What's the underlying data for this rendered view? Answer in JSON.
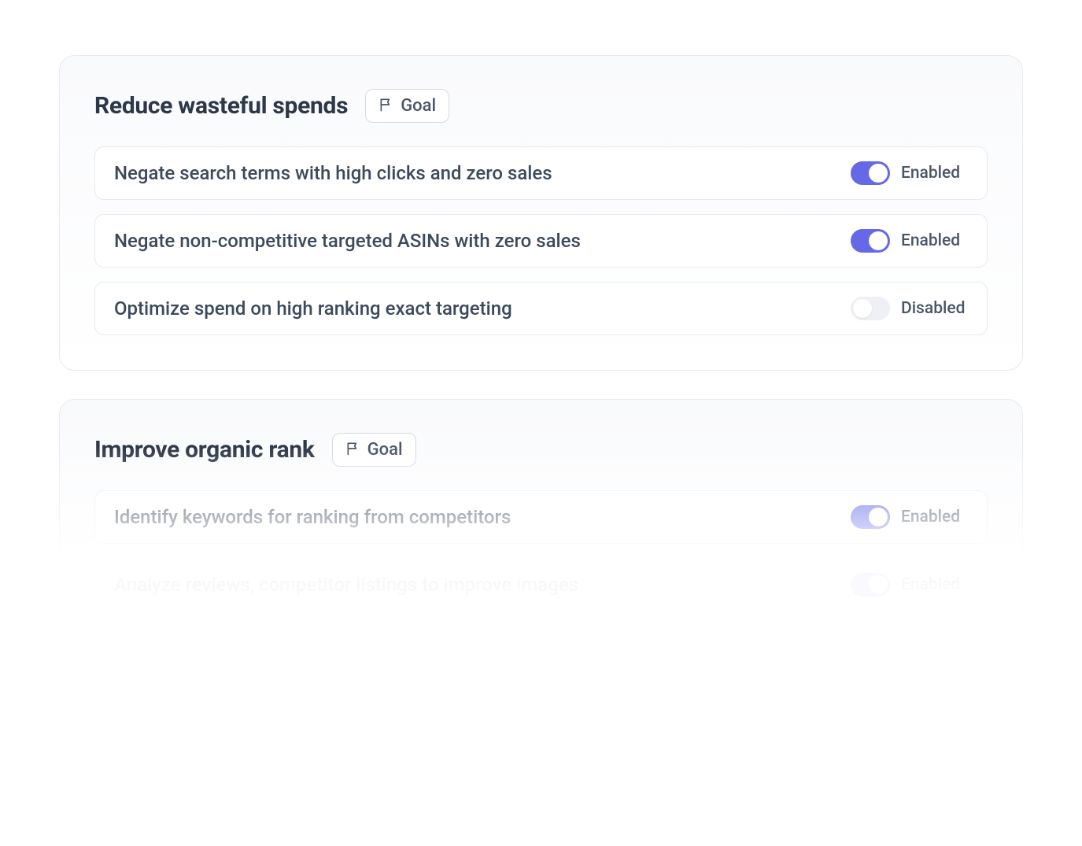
{
  "goal_badge_label": "Goal",
  "status": {
    "enabled": "Enabled",
    "disabled": "Disabled"
  },
  "cards": [
    {
      "title": "Reduce wasteful spends",
      "rules": [
        {
          "text": "Negate search terms with high clicks and zero sales",
          "enabled": true
        },
        {
          "text": "Negate non-competitive targeted ASINs with zero sales",
          "enabled": true
        },
        {
          "text": "Optimize spend on high ranking exact targeting",
          "enabled": false
        }
      ]
    },
    {
      "title": "Improve organic rank",
      "rules": [
        {
          "text": "Identify keywords for ranking from competitors",
          "enabled": true
        },
        {
          "text": "Analyze reviews, competitor listings to improve images",
          "enabled": true
        }
      ]
    }
  ]
}
